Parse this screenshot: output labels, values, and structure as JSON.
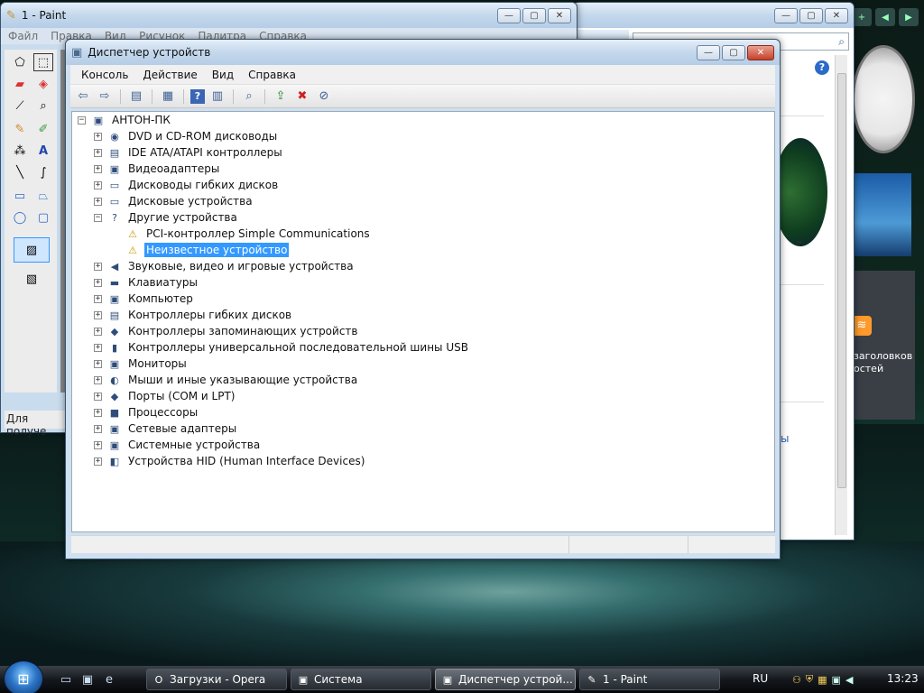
{
  "paint": {
    "title": "1 - Paint",
    "menu": [
      "Файл",
      "Правка",
      "Вид",
      "Рисунок",
      "Палитра",
      "Справка"
    ],
    "status": "Для получе"
  },
  "system": {
    "rss_text_1": "заголовков",
    "rss_text_2": "остей",
    "link_text": "ы",
    "tm": "™"
  },
  "devmgr": {
    "title": "Диспетчер устройств",
    "menu": [
      "Консоль",
      "Действие",
      "Вид",
      "Справка"
    ],
    "tree": {
      "root": "АНТОН-ПК",
      "items": [
        {
          "label": "DVD и CD-ROM дисководы",
          "icon": "cdrom-icon",
          "glyph": "◉",
          "expanded": false
        },
        {
          "label": "IDE ATA/ATAPI контроллеры",
          "icon": "ide-icon",
          "glyph": "▤",
          "expanded": false
        },
        {
          "label": "Видеоадаптеры",
          "icon": "display-adapter-icon",
          "glyph": "▣",
          "expanded": false
        },
        {
          "label": "Дисководы гибких дисков",
          "icon": "floppy-icon",
          "glyph": "▭",
          "expanded": false
        },
        {
          "label": "Дисковые устройства",
          "icon": "disk-icon",
          "glyph": "▭",
          "expanded": false
        },
        {
          "label": "Другие устройства",
          "icon": "other-devices-icon",
          "glyph": "?",
          "expanded": true
        },
        {
          "label": "PCI-контроллер Simple Communications",
          "icon": "warning-device-icon",
          "glyph": "⚠",
          "child": true
        },
        {
          "label": "Неизвестное устройство",
          "icon": "warning-device-icon",
          "glyph": "⚠",
          "child": true,
          "selected": true
        },
        {
          "label": "Звуковые, видео и игровые устройства",
          "icon": "speaker-icon",
          "glyph": "◀",
          "expanded": false
        },
        {
          "label": "Клавиатуры",
          "icon": "keyboard-icon",
          "glyph": "▬",
          "expanded": false
        },
        {
          "label": "Компьютер",
          "icon": "computer-icon",
          "glyph": "▣",
          "expanded": false
        },
        {
          "label": "Контроллеры гибких дисков",
          "icon": "floppy-controller-icon",
          "glyph": "▤",
          "expanded": false
        },
        {
          "label": "Контроллеры запоминающих устройств",
          "icon": "storage-controller-icon",
          "glyph": "◆",
          "expanded": false
        },
        {
          "label": "Контроллеры универсальной последовательной шины USB",
          "icon": "usb-icon",
          "glyph": "▮",
          "expanded": false
        },
        {
          "label": "Мониторы",
          "icon": "monitor-icon",
          "glyph": "▣",
          "expanded": false
        },
        {
          "label": "Мыши и иные указывающие устройства",
          "icon": "mouse-icon",
          "glyph": "◐",
          "expanded": false
        },
        {
          "label": "Порты (COM и LPT)",
          "icon": "port-icon",
          "glyph": "◆",
          "expanded": false
        },
        {
          "label": "Процессоры",
          "icon": "cpu-icon",
          "glyph": "■",
          "expanded": false
        },
        {
          "label": "Сетевые адаптеры",
          "icon": "network-icon",
          "glyph": "▣",
          "expanded": false
        },
        {
          "label": "Системные устройства",
          "icon": "system-devices-icon",
          "glyph": "▣",
          "expanded": false
        },
        {
          "label": "Устройства HID (Human Interface Devices)",
          "icon": "hid-icon",
          "glyph": "◧",
          "expanded": false
        }
      ]
    }
  },
  "taskbar": {
    "tasks": [
      {
        "label": "Загрузки - Opera",
        "icon": "opera-icon",
        "glyph": "O"
      },
      {
        "label": "Система",
        "icon": "system-icon",
        "glyph": "▣"
      },
      {
        "label": "Диспетчер устрой...",
        "icon": "device-manager-icon",
        "glyph": "▣",
        "active": true
      },
      {
        "label": "1 - Paint",
        "icon": "paint-icon",
        "glyph": "✎"
      }
    ],
    "lang": "RU",
    "time": "13:23"
  },
  "colors": {
    "selection": "#3399ff",
    "warning": "#c79a00"
  }
}
